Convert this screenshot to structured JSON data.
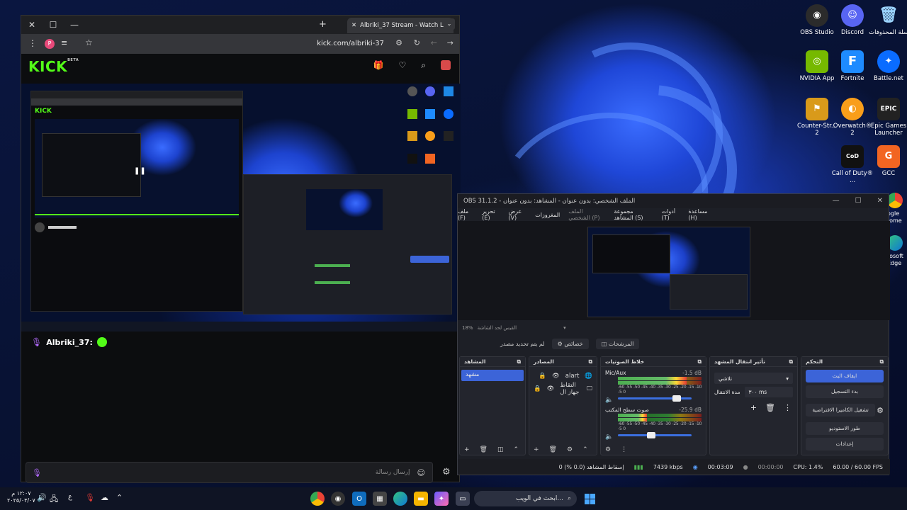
{
  "desktop": {
    "icons": [
      {
        "label": "OBS Studio",
        "icon": "obs-icon",
        "color": "#2b2b2b"
      },
      {
        "label": "Discord",
        "icon": "discord-icon",
        "color": "#5865f2"
      },
      {
        "label": "سلة المحذوفات",
        "icon": "recycle-bin-icon",
        "color": "#1e88e5"
      },
      {
        "label": "NVIDIA App",
        "icon": "nvidia-icon",
        "color": "#76b900"
      },
      {
        "label": "Fortnite",
        "icon": "fortnite-icon",
        "color": "#1e8bff"
      },
      {
        "label": "Battle.net",
        "icon": "battlenet-icon",
        "color": "#0a6cff"
      },
      {
        "label": "Counter-Str... 2",
        "icon": "cs2-icon",
        "color": "#d99a1a"
      },
      {
        "label": "Overwatch® 2",
        "icon": "overwatch-icon",
        "color": "#f99e1a"
      },
      {
        "label": "Epic Games Launcher",
        "icon": "epic-icon",
        "color": "#222222"
      },
      {
        "label": "Call of Duty® ...",
        "icon": "cod-icon",
        "color": "#111111"
      },
      {
        "label": "GCC",
        "icon": "gcc-icon",
        "color": "#f26522"
      }
    ],
    "edge_labels": [
      "ogle",
      "rome",
      "rosoft",
      "Edge"
    ]
  },
  "browser": {
    "tab_title": "Albriki_37 Stream - Watch L",
    "url": "kick.com/albriki-37",
    "profile_letter": "P",
    "brand_color": "#53fc18",
    "kick_logo": "KICK",
    "kick_beta": "BETA",
    "chat": {
      "username": "Albriki_37:",
      "message_placeholder": "إرسال رسالة"
    }
  },
  "obs": {
    "title": "OBS 31.1.2 - الملف الشخصي: بدون عنوان - المشاهد: بدون عنوان",
    "menu": [
      "مساعدة (H)",
      "أدوات (T)",
      "مجموعة المشاهد (S)",
      "الملف الشخصي (P)",
      "المغروزات",
      "عرض (V)",
      "تحرير (E)",
      "ملف (F)"
    ],
    "zoom": "18%",
    "scene_hint": "القيس لحد الشاشة",
    "no_source": "لم يتم تحديد مصدر",
    "properties": "خصائص",
    "filters": "المرشحات",
    "scenes_title": "المشاهد",
    "scenes": [
      "مشهد"
    ],
    "sources_title": "المصادر",
    "sources": [
      {
        "name": "alart",
        "icon": "globe-icon"
      },
      {
        "name": "التقاط جهاز ال",
        "icon": "monitor-icon"
      }
    ],
    "mixer_title": "خلاط الصوتيات",
    "mixer": [
      {
        "name": "Mic/Aux",
        "db": "-1.5 dB",
        "level": 0.82,
        "volume": 0.8
      },
      {
        "name": "صوت سطح المكتب",
        "db": "-25.9 dB",
        "level": 0.35,
        "volume": 0.45
      }
    ],
    "meter_scale": "-60 -55 -50 -45 -40 -35 -30 -25 -20 -15 -10 -5  0",
    "transitions_title": "تأثير انتقال المشهد",
    "transition": "تلاشي",
    "duration_label": "مدة الانتقال",
    "duration": "٣٠٠ ms",
    "controls_title": "التحكم",
    "controls": [
      "ايقاف البث",
      "بدء التسجيل",
      "تشغيل الكاميرا الافتراضية",
      "طور الاستوديو",
      "إعدادات"
    ],
    "status": {
      "dropped": "إسقاط المشاهد (0.0 %) 0",
      "bitrate": "7439 kbps",
      "live_time": "00:03:09",
      "rec_time": "00:00:00",
      "cpu": "CPU: 1.4%",
      "fps": "60.00 / 60.00 FPS"
    },
    "accent": "#3c64d8"
  },
  "taskbar": {
    "search_placeholder": "ابحث في الويب...",
    "time": "١٢:٠٧ م",
    "date": "٢٠٢٥/٠٣/٠٧",
    "lang": "ع"
  }
}
